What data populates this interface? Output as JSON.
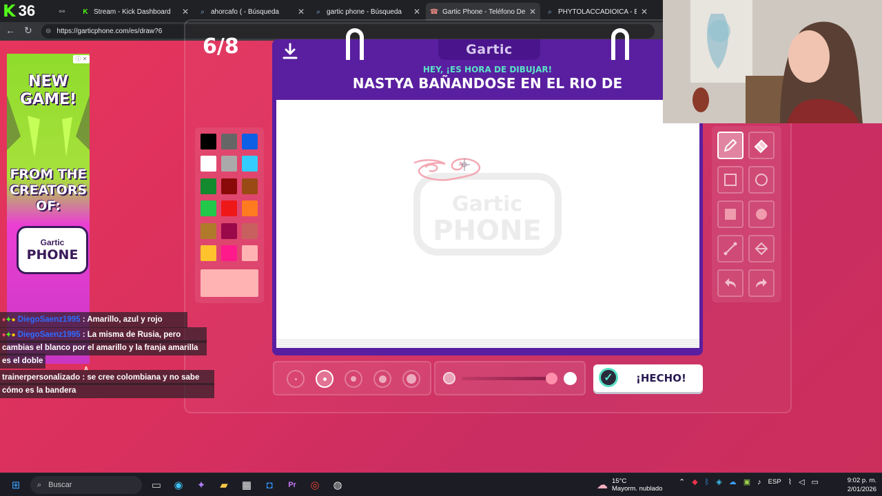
{
  "browser": {
    "stream_counter": "36",
    "tabs": [
      {
        "label": "",
        "icon": "extension-icon"
      },
      {
        "label": "Stream - Kick Dashboard",
        "icon": "kick-icon"
      },
      {
        "label": "ahorcafo ( - Búsqueda",
        "icon": "search-icon"
      },
      {
        "label": "gartic phone - Búsqueda",
        "icon": "search-icon"
      },
      {
        "label": "Gartic Phone - Teléfono Desco",
        "icon": "phone-icon",
        "active": true
      },
      {
        "label": "PHYTOLACCADIOICA - Búsque",
        "icon": "search-icon"
      }
    ],
    "url": "https://garticphone.com/es/draw?6"
  },
  "game": {
    "round": "6/8",
    "logo": "Gartic",
    "prompt_label": "HEY, ¡ES HORA DE DIBUJAR!",
    "prompt_text": "NASTYA BAÑANDOSE EN EL RIO DE",
    "watermark_top": "Gartic",
    "watermark_bottom": "PHONE",
    "done_label": "¡HECHO!",
    "palette": [
      "#000000",
      "#666666",
      "#0d5fe5",
      "#ffffff",
      "#aaaaaa",
      "#33ccff",
      "#138a2e",
      "#8a0a0a",
      "#9a4a14",
      "#21c84a",
      "#ef1818",
      "#ff7b20",
      "#b07a2a",
      "#9a0a4a",
      "#c96060",
      "#ffc32e",
      "#ff1a8c",
      "#ffb3b3"
    ],
    "current_color": "#ffb3b3",
    "selected_brush_size": 2,
    "brush_sizes": 5,
    "tools": [
      "pencil-icon",
      "eraser-icon",
      "rectangle-outline-icon",
      "circle-outline-icon",
      "rectangle-fill-icon",
      "circle-fill-icon",
      "line-icon",
      "fill-bucket-icon",
      "undo-icon",
      "redo-icon"
    ],
    "active_tool": "pencil-icon"
  },
  "ad": {
    "line1": "NEW",
    "line2": "GAME!",
    "line3": "FROM THE",
    "line4": "CREATORS",
    "line5": "OF:",
    "logo_top": "Gartic",
    "logo_bottom": "PHONE",
    "badge": "A"
  },
  "chat": [
    {
      "user": "DiegoSaenz1995",
      "text": ": Amarillo, azul y rojo"
    },
    {
      "user": "DiegoSaenz1995",
      "text": ": La misma de Rusia, pero"
    },
    {
      "text": "cambias el blanco por el amarillo y la franja amarilla"
    },
    {
      "text": "es el doble"
    },
    {
      "user": "trainerpersonalizado",
      "text": ": se cree colombiana y no sabe"
    },
    {
      "text": "cómo es la bandera"
    }
  ],
  "taskbar": {
    "search_placeholder": "Buscar",
    "weather_temp": "15°C",
    "weather_desc": "Mayorm. nublado",
    "language": "ESP",
    "time": "9:02 p. m.",
    "date": "2/01/2026"
  }
}
